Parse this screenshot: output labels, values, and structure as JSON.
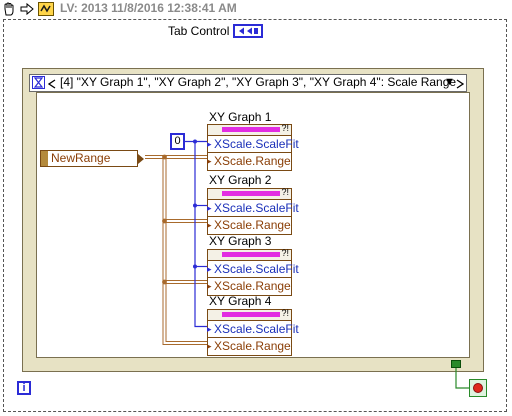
{
  "toolbar": {
    "title": "LV: 2013 11/8/2016 12:38:41 AM"
  },
  "tab_control": {
    "label": "Tab Control"
  },
  "case_selector": {
    "text": "[4] \"XY Graph 1\", \"XY Graph 2\", \"XY Graph 3\", \"XY Graph 4\": Scale Range",
    "arrow": "▼"
  },
  "input": {
    "label": "NewRange"
  },
  "constant": {
    "value": "0"
  },
  "property_nodes": [
    {
      "title": "XY Graph 1",
      "fit": "XScale.ScaleFit",
      "range": "XScale.Range"
    },
    {
      "title": "XY Graph 2",
      "fit": "XScale.ScaleFit",
      "range": "XScale.Range"
    },
    {
      "title": "XY Graph 3",
      "fit": "XScale.ScaleFit",
      "range": "XScale.Range"
    },
    {
      "title": "XY Graph 4",
      "fit": "XScale.ScaleFit",
      "range": "XScale.Range"
    }
  ],
  "info_icon": {
    "glyph": "i"
  },
  "colors": {
    "cluster_wire": "#b0783a",
    "numeric_wire": "#2b2bd6",
    "bool_wire": "#2a8a2a",
    "frame_fill": "#e7e2c4",
    "property_bar": "#e22de2"
  }
}
